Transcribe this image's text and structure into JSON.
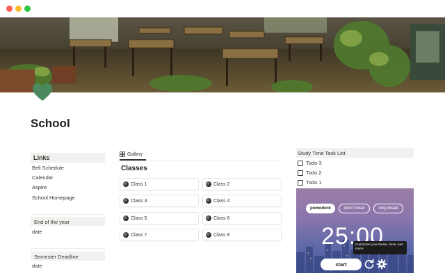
{
  "page": {
    "title": "School"
  },
  "links": {
    "heading": "Links",
    "items": [
      {
        "label": "Bell Schedule"
      },
      {
        "label": "Calendar"
      },
      {
        "label": "Aspire"
      },
      {
        "label": "School Homepage"
      }
    ]
  },
  "sections": [
    {
      "heading": "End of the year",
      "value": "date"
    },
    {
      "heading": "Semester Deadline",
      "value": "date"
    }
  ],
  "gallery": {
    "tab_label": "Gallery",
    "title": "Classes",
    "cards": [
      {
        "label": "Class 1"
      },
      {
        "label": "Class 2"
      },
      {
        "label": "Class 3"
      },
      {
        "label": "Class 4"
      },
      {
        "label": "Class 5"
      },
      {
        "label": "Class 6"
      },
      {
        "label": "Class 7"
      },
      {
        "label": "Class 8"
      }
    ]
  },
  "tasks": {
    "heading": "Study Time Task List",
    "items": [
      {
        "label": "Todo 3",
        "checked": false
      },
      {
        "label": "Todo 2",
        "checked": false
      },
      {
        "label": "Todo 1",
        "checked": false
      }
    ]
  },
  "pomodoro": {
    "modes": [
      {
        "label": "pomodoro",
        "active": true
      },
      {
        "label": "short break",
        "active": false
      },
      {
        "label": "long break",
        "active": false
      }
    ],
    "timer": "25:00",
    "tooltip": "Customize your theme, timer, and more!",
    "start_label": "start",
    "icons": [
      "refresh-icon",
      "gear-icon"
    ]
  },
  "colors": {
    "page_icon": "#4a8a5e",
    "header_bg": "#f1f1ef"
  }
}
